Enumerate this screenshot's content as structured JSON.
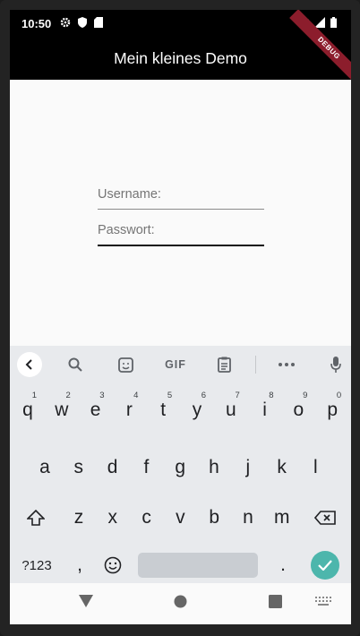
{
  "status_bar": {
    "time": "10:50"
  },
  "app_bar": {
    "title": "Mein kleines Demo",
    "debug_banner": "DEBUG"
  },
  "form": {
    "username_label": "Username:",
    "password_label": "Passwort:"
  },
  "keyboard": {
    "toolbar": {
      "gif_label": "GIF"
    },
    "row1": [
      {
        "k": "q",
        "h": "1"
      },
      {
        "k": "w",
        "h": "2"
      },
      {
        "k": "e",
        "h": "3"
      },
      {
        "k": "r",
        "h": "4"
      },
      {
        "k": "t",
        "h": "5"
      },
      {
        "k": "y",
        "h": "6"
      },
      {
        "k": "u",
        "h": "7"
      },
      {
        "k": "i",
        "h": "8"
      },
      {
        "k": "o",
        "h": "9"
      },
      {
        "k": "p",
        "h": "0"
      }
    ],
    "row2": [
      "a",
      "s",
      "d",
      "f",
      "g",
      "h",
      "j",
      "k",
      "l"
    ],
    "row3": [
      "z",
      "x",
      "c",
      "v",
      "b",
      "n",
      "m"
    ],
    "symbols_label": "?123",
    "comma": ",",
    "period": "."
  },
  "colors": {
    "app_bar": "#000000",
    "accent_enter": "#4db6ac",
    "debug_banner": "#8c1d2c"
  }
}
